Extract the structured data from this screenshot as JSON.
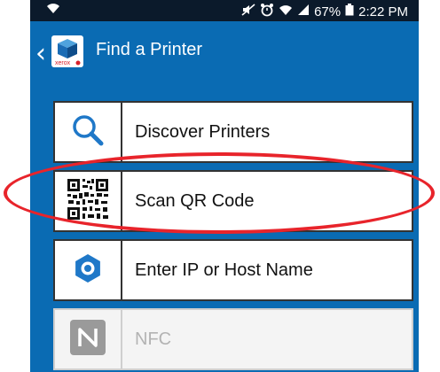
{
  "status_bar": {
    "time": "2:22 PM",
    "battery": "67%",
    "icons": [
      "wifi-icon",
      "mute-icon",
      "alarm-icon",
      "wifi-icon",
      "signal-icon",
      "battery-icon"
    ]
  },
  "app_bar": {
    "title": "Find a Printer",
    "logo_text": "xerox"
  },
  "menu": {
    "items": [
      {
        "label": "Discover Printers",
        "icon": "search-icon"
      },
      {
        "label": "Scan QR Code",
        "icon": "qr-code-icon"
      },
      {
        "label": "Enter IP or Host Name",
        "icon": "gear-icon"
      },
      {
        "label": "NFC",
        "icon": "nfc-icon"
      }
    ]
  },
  "colors": {
    "app_bar": "#0a6bb3",
    "status_bar": "#0b1a2b",
    "icon_blue": "#1f78c8",
    "highlight": "#e8242b"
  }
}
